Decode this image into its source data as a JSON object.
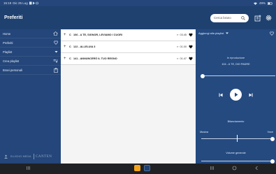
{
  "status_bar": {
    "time": "15:19",
    "date": "Dic 25 Lug",
    "battery": "49%"
  },
  "header": {
    "title": "Preferiti",
    "search_placeholder": "Cerca brano"
  },
  "sidebar": {
    "items": [
      {
        "label": "Home",
        "icon": "home-icon"
      },
      {
        "label": "Preferiti",
        "icon": "heart-icon"
      },
      {
        "label": "Playlist",
        "icon": "chevron-down-icon"
      },
      {
        "label": "Crea playlist",
        "icon": "playlist-add-icon"
      },
      {
        "label": "Brani personali",
        "icon": "upload-icon"
      }
    ],
    "brand_left": "ELLEDICI MEDIA",
    "brand_right": "CANTEN"
  },
  "songs": [
    {
      "code": "C",
      "title": "106 - A TE, SIGNOR, LEVIAMO I CUORI",
      "duration": "03.45"
    },
    {
      "code": "C",
      "title": "122 - ALLELUIA 3",
      "duration": "01.00"
    },
    {
      "code": "C",
      "title": "141 - ANNUNCERÒ IL TUO REGNO",
      "duration": "01.47"
    }
  ],
  "player": {
    "add_to_playlist": "Aggiungi alla playlist",
    "now_playing_label": "In riproduzione",
    "now_playing_song": "104 - A TE, DIO PADRE",
    "balance_label": "Bilanciamento",
    "music_label": "Musica",
    "voice_label": "Voce",
    "volume_label": "Volume generale",
    "progress": 0.0,
    "balance": 0.5,
    "volume": 1.0
  },
  "colors": {
    "header_bg": "#1e4170",
    "sidebar_bg": "#24467a",
    "accent": "#ffffff"
  }
}
